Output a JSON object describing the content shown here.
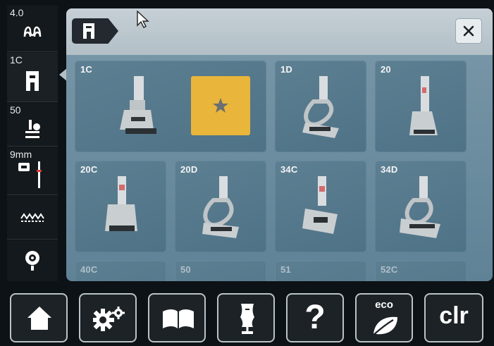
{
  "sidebar": {
    "items": [
      {
        "label": "4.0",
        "icon": "stitch-width-icon"
      },
      {
        "label": "1C",
        "icon": "presser-foot-icon"
      },
      {
        "label": "50",
        "icon": "needle-position-icon"
      },
      {
        "label": "9mm",
        "icon": "stitch-plate-needle-icon"
      },
      {
        "label": "",
        "icon": "zigzag-stitch-icon"
      },
      {
        "label": "",
        "icon": "bobbin-thread-icon"
      }
    ]
  },
  "header": {
    "breadcrumb_icon": "presser-foot-icon",
    "close_icon": "close-icon"
  },
  "feet": {
    "tiles": [
      {
        "label": "1C"
      },
      {
        "label": "1D"
      },
      {
        "label": "20"
      },
      {
        "label": "20C"
      },
      {
        "label": "20D"
      },
      {
        "label": "34C"
      },
      {
        "label": "34D"
      },
      {
        "label": "40C"
      },
      {
        "label": "50"
      },
      {
        "label": "51"
      },
      {
        "label": "52C"
      }
    ],
    "favorite_icon": "star-icon",
    "favorite_color": "#e9b53a"
  },
  "toolbar": {
    "buttons": [
      {
        "icon": "home-icon"
      },
      {
        "icon": "settings-icon"
      },
      {
        "icon": "tutorial-book-icon"
      },
      {
        "icon": "sewing-consultant-icon"
      },
      {
        "label": "?",
        "icon": "help-icon"
      },
      {
        "label": "eco",
        "icon": "eco-leaf-icon"
      },
      {
        "label": "clr",
        "icon": "clear-icon"
      }
    ]
  }
}
